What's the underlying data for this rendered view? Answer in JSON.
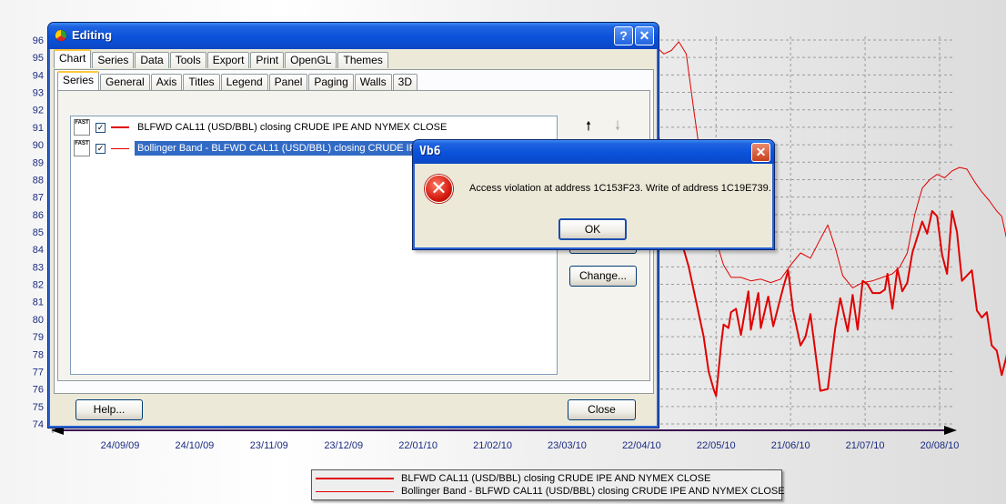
{
  "chart_data": {
    "type": "line",
    "title": "",
    "xlabel": "",
    "ylabel": "",
    "ylim": [
      74,
      96
    ],
    "y_ticks": [
      "96",
      "95",
      "94",
      "93",
      "92",
      "91",
      "90",
      "89",
      "88",
      "87",
      "86",
      "85",
      "84",
      "83",
      "82",
      "81",
      "80",
      "79",
      "78",
      "77",
      "76",
      "75",
      "74"
    ],
    "x_ticks": [
      "24/09/09",
      "24/10/09",
      "23/11/09",
      "23/12/09",
      "22/01/10",
      "21/02/10",
      "23/03/10",
      "22/04/10",
      "22/05/10",
      "21/06/10",
      "21/07/10",
      "20/08/10"
    ],
    "grid": true,
    "legend_position": "bottom-center",
    "series": [
      {
        "name": "BLFWD CAL11 (USD/BBL) closing CRUDE IPE AND NYMEX CLOSE",
        "color": "#e00000",
        "points": [
          [
            "22/04/10",
            91.3
          ],
          [
            "24/04/10",
            93.2
          ],
          [
            "26/04/10",
            94.0
          ],
          [
            "27/04/10",
            92.8
          ],
          [
            "30/04/10",
            89.0
          ],
          [
            "05/05/10",
            87.0
          ],
          [
            "08/05/10",
            84.5
          ],
          [
            "11/05/10",
            83.0
          ],
          [
            "14/05/10",
            81.0
          ],
          [
            "17/05/10",
            79.0
          ],
          [
            "19/05/10",
            77.0
          ],
          [
            "21/05/10",
            76.0
          ],
          [
            "22/05/10",
            75.6
          ],
          [
            "24/05/10",
            78.5
          ],
          [
            "25/05/10",
            79.7
          ],
          [
            "27/05/10",
            79.5
          ],
          [
            "28/05/10",
            80.4
          ],
          [
            "30/05/10",
            80.6
          ],
          [
            "01/06/10",
            79.1
          ],
          [
            "04/06/10",
            81.6
          ],
          [
            "05/06/10",
            79.4
          ],
          [
            "08/06/10",
            81.5
          ],
          [
            "09/06/10",
            79.5
          ],
          [
            "12/06/10",
            81.3
          ],
          [
            "14/06/10",
            79.6
          ],
          [
            "16/06/10",
            80.7
          ],
          [
            "18/06/10",
            81.8
          ],
          [
            "20/06/10",
            82.8
          ],
          [
            "22/06/10",
            80.5
          ],
          [
            "25/06/10",
            78.5
          ],
          [
            "27/06/10",
            79.0
          ],
          [
            "29/06/10",
            80.3
          ],
          [
            "03/07/10",
            75.9
          ],
          [
            "06/07/10",
            76.0
          ],
          [
            "09/07/10",
            79.5
          ],
          [
            "11/07/10",
            81.2
          ],
          [
            "14/07/10",
            79.3
          ],
          [
            "16/07/10",
            81.4
          ],
          [
            "18/07/10",
            79.4
          ],
          [
            "20/07/10",
            82.2
          ],
          [
            "22/07/10",
            82.0
          ],
          [
            "24/07/10",
            81.5
          ],
          [
            "27/07/10",
            81.5
          ],
          [
            "29/07/10",
            81.7
          ],
          [
            "30/07/10",
            82.6
          ],
          [
            "01/08/10",
            80.6
          ],
          [
            "03/08/10",
            82.9
          ],
          [
            "05/08/10",
            81.6
          ],
          [
            "07/08/10",
            82.1
          ],
          [
            "09/08/10",
            83.8
          ],
          [
            "11/08/10",
            84.7
          ],
          [
            "13/08/10",
            85.6
          ],
          [
            "15/08/10",
            84.9
          ],
          [
            "17/08/10",
            86.2
          ],
          [
            "19/08/10",
            85.9
          ],
          [
            "21/08/10",
            83.7
          ],
          [
            "23/08/10",
            82.6
          ],
          [
            "25/08/10",
            86.2
          ],
          [
            "27/08/10",
            85.0
          ],
          [
            "29/08/10",
            82.2
          ],
          [
            "02/09/10",
            82.8
          ],
          [
            "04/09/10",
            80.5
          ],
          [
            "06/09/10",
            80.1
          ],
          [
            "08/09/10",
            80.4
          ],
          [
            "10/09/10",
            78.5
          ],
          [
            "12/09/10",
            78.2
          ],
          [
            "14/09/10",
            76.8
          ],
          [
            "16/09/10",
            77.9
          ],
          [
            "17/09/10",
            79.1
          ]
        ]
      },
      {
        "name": "Bollinger Band - BLFWD CAL11 (USD/BBL) closing CRUDE IPE AND NYMEX CLOSE",
        "color": "#e00000",
        "points": [
          [
            "22/04/10",
            92.5
          ],
          [
            "25/04/10",
            94.4
          ],
          [
            "28/04/10",
            95.6
          ],
          [
            "01/05/10",
            95.2
          ],
          [
            "04/05/10",
            95.4
          ],
          [
            "07/05/10",
            95.9
          ],
          [
            "10/05/10",
            95.2
          ],
          [
            "13/05/10",
            92.0
          ],
          [
            "16/05/10",
            89.0
          ],
          [
            "19/05/10",
            86.6
          ],
          [
            "22/05/10",
            84.5
          ],
          [
            "25/05/10",
            83.1
          ],
          [
            "28/05/10",
            82.4
          ],
          [
            "01/06/10",
            82.4
          ],
          [
            "05/06/10",
            82.2
          ],
          [
            "09/06/10",
            82.3
          ],
          [
            "13/06/10",
            82.1
          ],
          [
            "17/06/10",
            82.3
          ],
          [
            "21/06/10",
            83.1
          ],
          [
            "25/06/10",
            83.8
          ],
          [
            "29/06/10",
            83.5
          ],
          [
            "03/07/10",
            84.6
          ],
          [
            "06/07/10",
            85.4
          ],
          [
            "09/07/10",
            84.1
          ],
          [
            "12/07/10",
            82.5
          ],
          [
            "16/07/10",
            81.8
          ],
          [
            "20/07/10",
            82.1
          ],
          [
            "24/07/10",
            82.2
          ],
          [
            "28/07/10",
            82.4
          ],
          [
            "01/08/10",
            82.6
          ],
          [
            "04/08/10",
            83.0
          ],
          [
            "07/08/10",
            83.8
          ],
          [
            "10/08/10",
            86.0
          ],
          [
            "13/08/10",
            87.5
          ],
          [
            "16/08/10",
            88.0
          ],
          [
            "19/08/10",
            88.3
          ],
          [
            "22/08/10",
            88.1
          ],
          [
            "25/08/10",
            88.5
          ],
          [
            "28/08/10",
            88.7
          ],
          [
            "31/08/10",
            88.6
          ],
          [
            "03/09/10",
            87.9
          ],
          [
            "06/09/10",
            87.3
          ],
          [
            "09/09/10",
            86.8
          ],
          [
            "12/09/10",
            86.2
          ],
          [
            "14/09/10",
            85.9
          ],
          [
            "16/09/10",
            84.6
          ],
          [
            "17/09/10",
            82.6
          ]
        ]
      }
    ]
  },
  "legend": {
    "items": [
      "BLFWD CAL11 (USD/BBL) closing CRUDE IPE AND NYMEX CLOSE",
      "Bollinger Band - BLFWD CAL11 (USD/BBL) closing CRUDE IPE AND NYMEX CLOSE"
    ]
  },
  "editing": {
    "title": "Editing",
    "help_label": "?",
    "close_label": "✕",
    "tabs": [
      "Chart",
      "Series",
      "Data",
      "Tools",
      "Export",
      "Print",
      "OpenGL",
      "Themes"
    ],
    "subtabs": [
      "Series",
      "General",
      "Axis",
      "Titles",
      "Legend",
      "Panel",
      "Paging",
      "Walls",
      "3D"
    ],
    "series_list": [
      {
        "label": "BLFWD CAL11 (USD/BBL) closing CRUDE IPE AND NYMEX CLOSE",
        "checked": true,
        "selected": false
      },
      {
        "label": "Bollinger Band - BLFWD CAL11 (USD/BBL) closing CRUDE IPE AND NYMEX CLOSE",
        "checked": true,
        "selected": true
      }
    ],
    "fast_icon_text": "FAST",
    "check_mark": "✓",
    "up_arrow": "🠕",
    "down_arrow": "🠗",
    "change_button": "Change...",
    "help_button": "Help...",
    "close_button": "Close"
  },
  "error_dialog": {
    "title": "Vb6",
    "close_label": "✕",
    "icon_glyph": "✕",
    "message": "Access violation at address 1C153F23. Write of address 1C19E739.",
    "ok_button": "OK"
  }
}
